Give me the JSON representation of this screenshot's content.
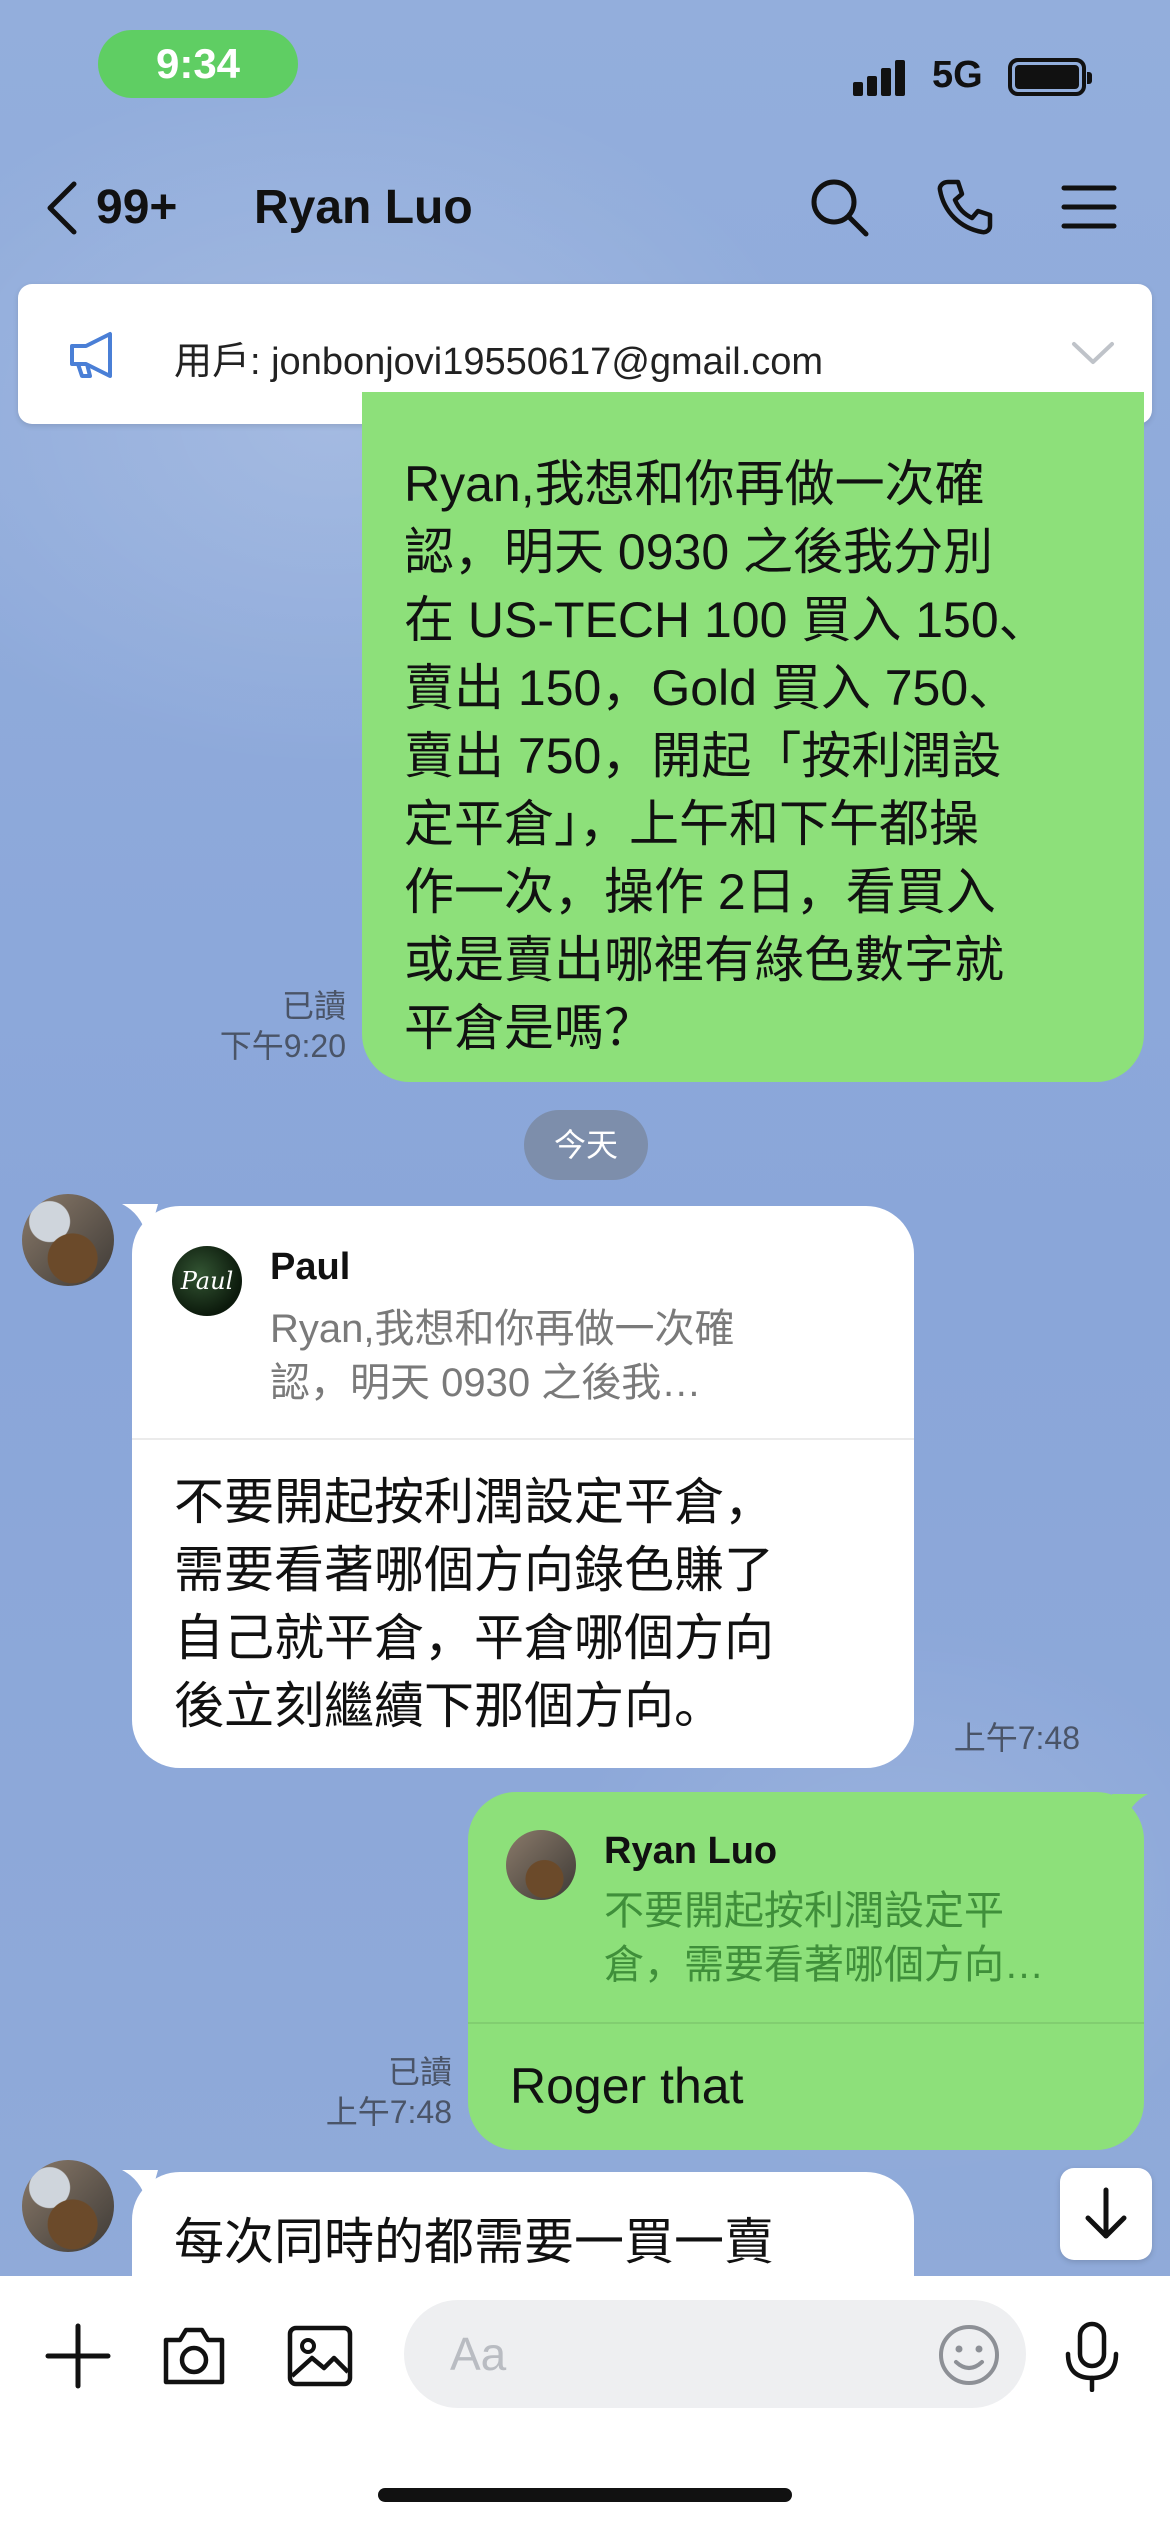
{
  "status_bar": {
    "time": "9:34",
    "network": "5G"
  },
  "header": {
    "back_count": "99+",
    "title": "Ryan Luo"
  },
  "announcement": {
    "text": "用戶: jonbonjovi19550617@gmail.com"
  },
  "messages": [
    {
      "side": "outgoing",
      "lines": [
        "Ryan,我想和你再做一次確",
        "認，明天 0930 之後我分別",
        "在 US-TECH 100 買入 150、",
        "賣出 150，Gold 買入 750、",
        "賣出 750，開起「按利潤設",
        "定平倉」，上午和下午都操",
        "作一次，操作 2日，看買入",
        "或是賣出哪裡有綠色數字就",
        "平倉是嗎？"
      ],
      "read": "已讀",
      "time": "下午9:20"
    },
    {
      "side": "incoming",
      "reply_to": {
        "name": "Paul",
        "avatar_text": "Paul",
        "snippet_lines": [
          "Ryan,我想和你再做一次確",
          "認，明天 0930 之後我…"
        ]
      },
      "lines": [
        "不要開起按利潤設定平倉，",
        "需要看著哪個方向錄色賺了",
        "自己就平倉，平倉哪個方向",
        "後立刻繼續下那個方向。"
      ],
      "time": "上午7:48"
    },
    {
      "side": "outgoing",
      "reply_to": {
        "name": "Ryan Luo",
        "snippet_lines": [
          "不要開起按利潤設定平",
          "倉，需要看著哪個方向…"
        ]
      },
      "lines": [
        "Roger that"
      ],
      "read": "已讀",
      "time": "上午7:48"
    },
    {
      "side": "incoming",
      "lines": [
        "每次同時的都需要一買一賣"
      ]
    }
  ],
  "date_divider": "今天",
  "composer": {
    "placeholder": "Aa"
  },
  "icons": [
    "back-chevron-icon",
    "search-icon",
    "phone-icon",
    "menu-icon",
    "megaphone-icon",
    "chevron-down-icon",
    "arrow-down-icon",
    "plus-icon",
    "camera-icon",
    "image-icon",
    "emoji-icon",
    "microphone-icon"
  ],
  "colors": {
    "background": "#8ba8d8",
    "outgoing_bubble": "#8de07a",
    "incoming_bubble": "#ffffff",
    "status_pill": "#5fce63"
  }
}
